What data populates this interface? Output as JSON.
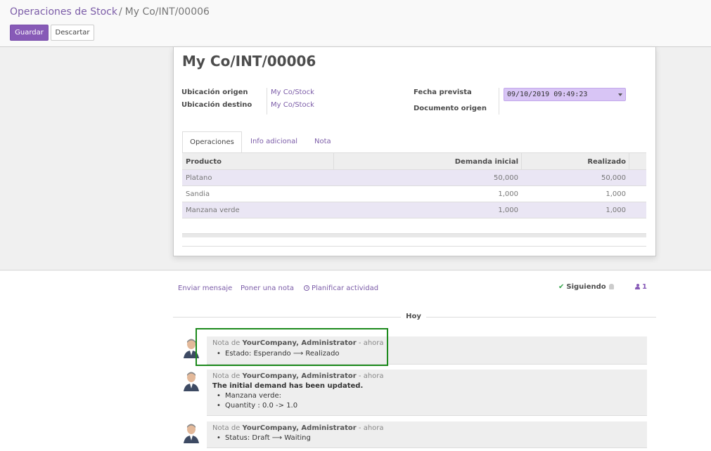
{
  "breadcrumb": {
    "parent": "Operaciones de Stock",
    "separator": "/",
    "current": "My Co/INT/00006"
  },
  "toolbar": {
    "save_label": "Guardar",
    "discard_label": "Descartar"
  },
  "form": {
    "title": "My Co/INT/00006",
    "source_location_label": "Ubicación origen",
    "source_location_value": "My Co/Stock",
    "dest_location_label": "Ubicación destino",
    "dest_location_value": "My Co/Stock",
    "scheduled_date_label": "Fecha prevista",
    "scheduled_date_value": "09/10/2019 09:49:23",
    "source_document_label": "Documento origen"
  },
  "tabs": [
    {
      "label": "Operaciones",
      "active": true
    },
    {
      "label": "Info adicional",
      "active": false
    },
    {
      "label": "Nota",
      "active": false
    }
  ],
  "table": {
    "headers": [
      "Producto",
      "Demanda inicial",
      "Realizado"
    ],
    "rows": [
      {
        "product": "Platano",
        "demand": "50,000",
        "done": "50,000"
      },
      {
        "product": "Sandia",
        "demand": "1,000",
        "done": "1,000"
      },
      {
        "product": "Manzana verde",
        "demand": "1,000",
        "done": "1,000"
      }
    ]
  },
  "chatter": {
    "send_message": "Enviar mensaje",
    "log_note": "Poner una nota",
    "schedule_activity": "Planificar actividad",
    "following": "Siguiendo",
    "followers_count": "1",
    "day_label": "Hoy",
    "messages": [
      {
        "prefix": "Nota de",
        "author": "YourCompany, Administrator",
        "time": "- ahora",
        "bullets": [
          "Estado: Esperando ⟶ Realizado"
        ]
      },
      {
        "prefix": "Nota de",
        "author": "YourCompany, Administrator",
        "time": "- ahora",
        "body": "The initial demand has been updated.",
        "bullets": [
          "Manzana verde:",
          "Quantity : 0.0 -> 1.0"
        ]
      },
      {
        "prefix": "Nota de",
        "author": "YourCompany, Administrator",
        "time": "- ahora",
        "bullets": [
          "Status: Draft ⟶ Waiting"
        ]
      }
    ]
  },
  "colors": {
    "accent": "#875ab7",
    "link": "#7c5da8",
    "highlight_box": "#1c8a1c",
    "date_field_bg": "#d8c5f5"
  }
}
